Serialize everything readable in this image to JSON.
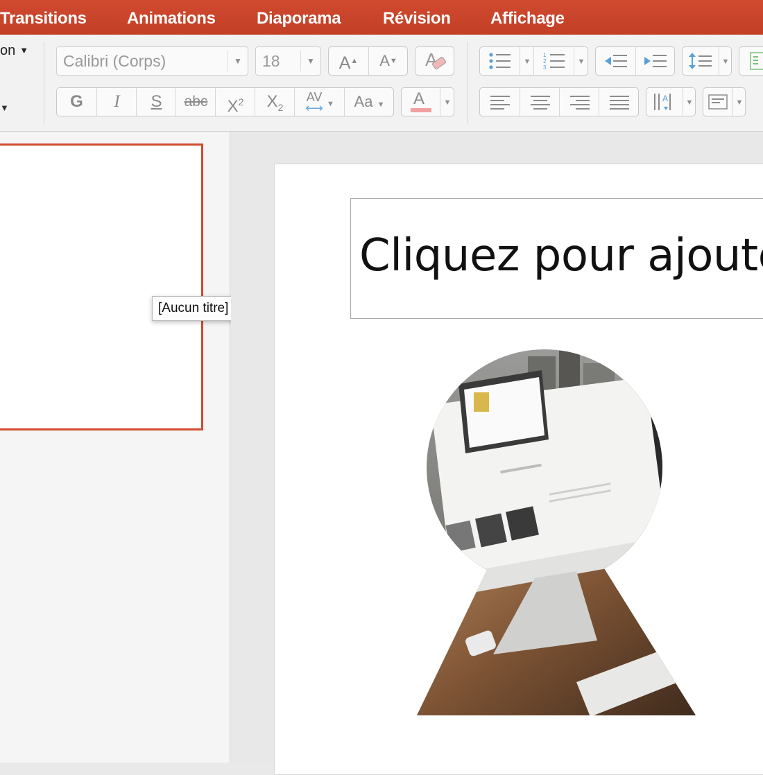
{
  "tabs": [
    "Transitions",
    "Animations",
    "Diaporama",
    "Révision",
    "Affichage"
  ],
  "clipboard": {
    "partial_label": "on"
  },
  "font": {
    "family_value": "Calibri (Corps)",
    "size_value": "18",
    "grow_label": "A",
    "shrink_label": "A",
    "bold_label": "G",
    "italic_label": "I",
    "underline_label": "S",
    "strike_label": "abc",
    "superscript_label": "X",
    "superscript_mark": "2",
    "subscript_label": "X",
    "subscript_mark": "2",
    "spacing_label": "AV",
    "case_label": "Aa",
    "color_label": "A",
    "color_bar": "#f0a0a0"
  },
  "paragraph": {
    "numbering_marks": [
      "1",
      "2",
      "3"
    ],
    "text_direction_label": "A"
  },
  "thumbnail": {
    "tooltip": "[Aucun titre]"
  },
  "slide": {
    "title_placeholder": "Cliquez pour ajouter"
  },
  "colors": {
    "accent": "#c9432a",
    "thumb_border": "#d24a2e"
  },
  "icons": [
    "chevron-down-icon",
    "grow-font-icon",
    "shrink-font-icon",
    "clear-format-icon",
    "bullets-icon",
    "numbering-icon",
    "decrease-indent-icon",
    "increase-indent-icon",
    "line-spacing-icon",
    "align-left-icon",
    "align-center-icon",
    "align-right-icon",
    "justify-icon",
    "text-direction-icon",
    "align-text-icon",
    "columns-icon"
  ]
}
